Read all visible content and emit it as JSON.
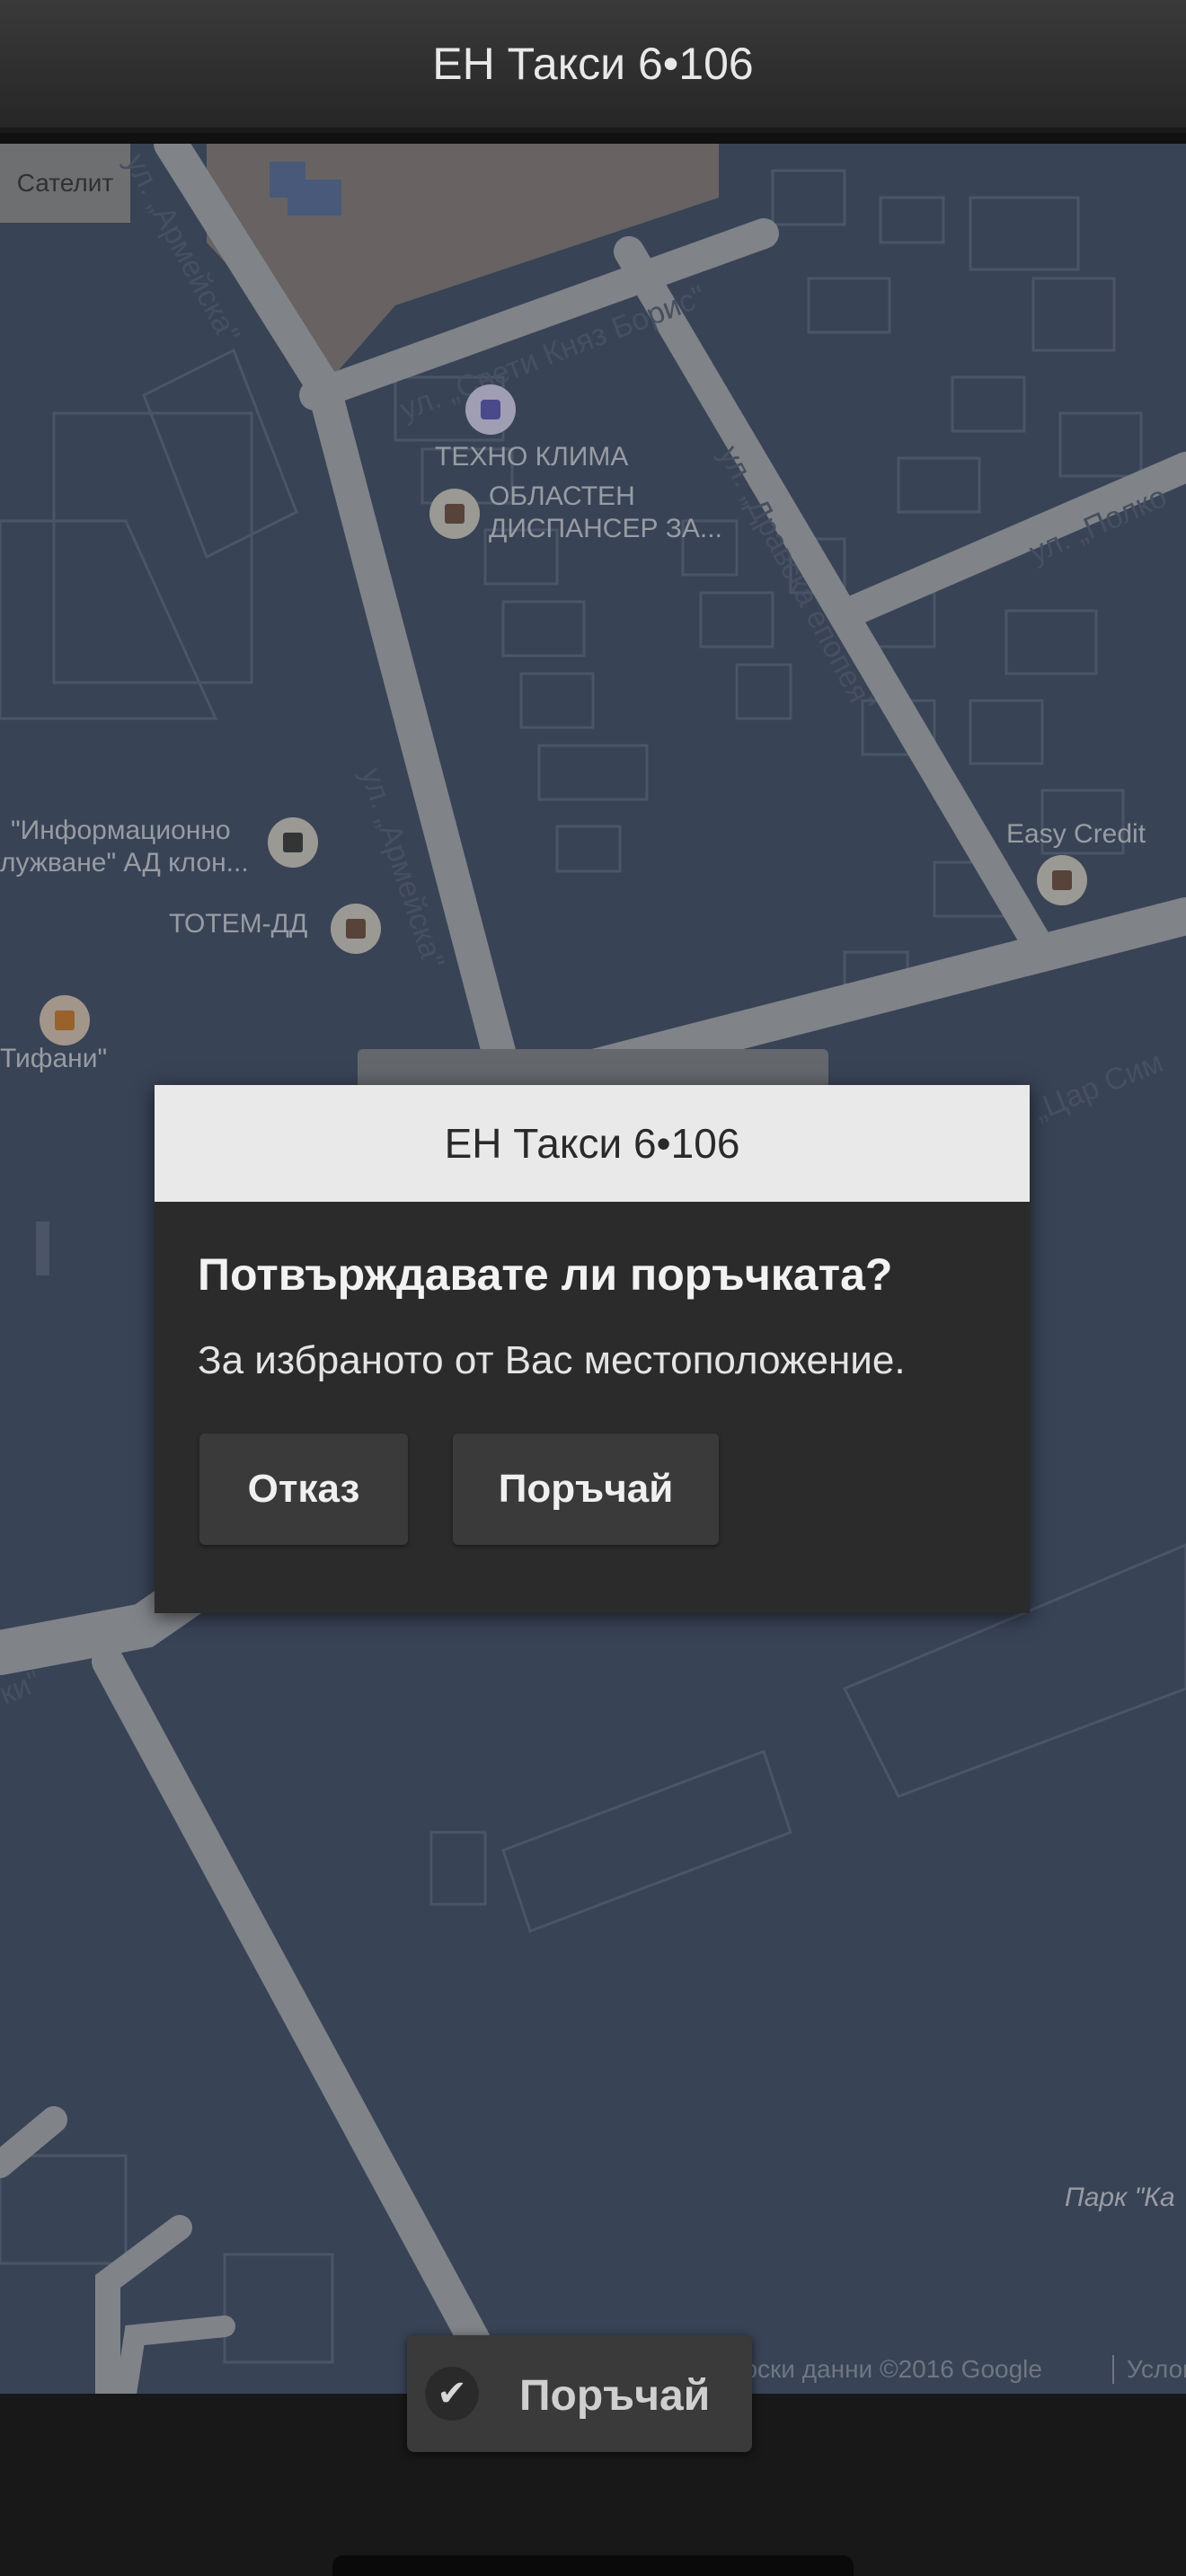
{
  "app": {
    "title": "ЕН Такси 6•106"
  },
  "map": {
    "satellite_label": "Сателит",
    "streets": [
      "ул. „Армейска\"",
      "ул. „Свети Княз Борис\"",
      "ул. „Армейска\"",
      "ул. „Дравска епопея\"",
      "ул. „Полко",
      "„Цар Сим",
      "ки\""
    ],
    "places": {
      "tehno": "ТЕХНО КЛИМА",
      "dispanser_1": "ОБЛАСТЕН",
      "dispanser_2": "ДИСПАНСЕР ЗА...",
      "info_1": "\"Информационно",
      "info_2": "лужване\" АД клон...",
      "totem": "ТОТЕМ-ДД",
      "tifani": "Тифани\"",
      "easy": "Easy Credit",
      "park": "Парк \"Ка"
    },
    "copyright": "фски данни ©2016 Google",
    "terms": "Услов"
  },
  "dialog": {
    "title": "ЕН Такси 6•106",
    "question": "Потвърждавате ли поръчката?",
    "message": "За избраното от Вас местоположение.",
    "cancel_label": "Отказ",
    "confirm_label": "Поръчай"
  },
  "order_button": {
    "label": "Поръчай",
    "icon": "check-icon"
  }
}
